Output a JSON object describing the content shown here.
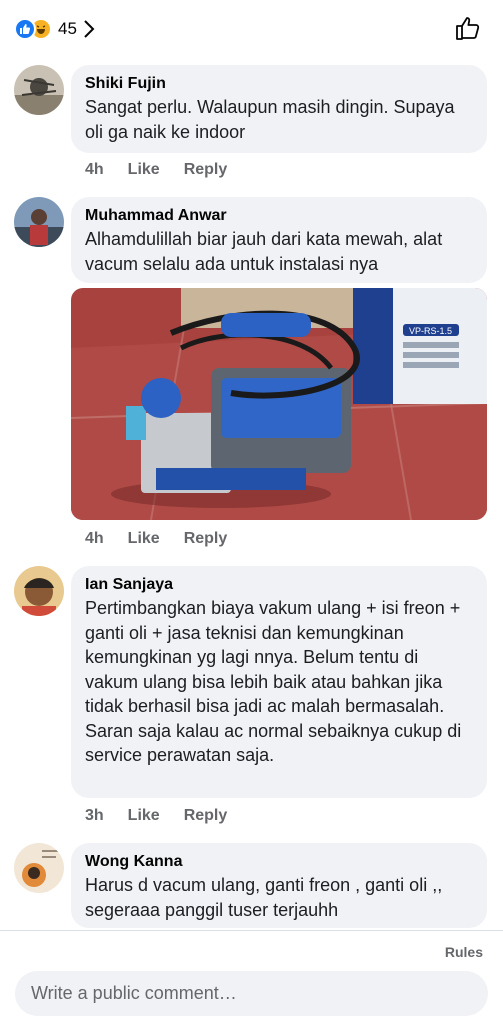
{
  "reactions": {
    "count": "45"
  },
  "comments": [
    {
      "author": "Shiki Fujin",
      "text": "Sangat perlu. Walaupun masih dingin. Supaya oli ga naik ke indoor",
      "time": "4h",
      "like": "Like",
      "reply": "Reply"
    },
    {
      "author": "Muhammad Anwar",
      "text": "Alhamdulillah biar jauh dari kata mewah, alat vacum selalu ada untuk instalasi nya",
      "time": "4h",
      "like": "Like",
      "reply": "Reply",
      "photo_box_label": "VP-RS-1.5"
    },
    {
      "author": "Ian Sanjaya",
      "text": "Pertimbangkan biaya vakum ulang + isi freon + ganti oli + jasa teknisi dan kemungkinan kemungkinan yg lagi nnya. Belum tentu di vakum ulang bisa lebih baik atau bahkan jika tidak berhasil bisa jadi ac malah bermasalah. Saran saja kalau ac normal sebaiknya cukup di service perawatan saja.",
      "time": "3h",
      "like": "Like",
      "reply": "Reply"
    },
    {
      "author": "Wong Kanna",
      "text": "Harus d vacum ulang, ganti freon , ganti oli ,, segeraaa panggil tuser terjauhh"
    }
  ],
  "footer": {
    "rules": "Rules",
    "comment_placeholder": "Write a public comment…"
  },
  "colors": {
    "like_blue": "#1877f2",
    "bubble_bg": "#f0f2f5",
    "meta_gray": "#65676b"
  }
}
